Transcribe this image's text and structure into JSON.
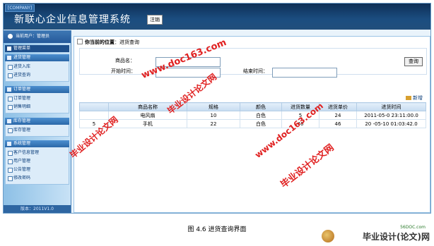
{
  "header": {
    "company": "[COMPANY]",
    "title": "新联心企业信息管理系统",
    "logout": "注销"
  },
  "sidebar": {
    "current_user": "当前用户：管理员",
    "menu_title": "管理菜单",
    "groups": [
      {
        "title": "进货管理",
        "items": [
          "进货入库",
          "进货查询"
        ]
      },
      {
        "title": "订单管理",
        "items": [
          "订单管理",
          "销售明细"
        ]
      },
      {
        "title": "库存管理",
        "items": [
          "库存管理"
        ]
      },
      {
        "title": "系统管理",
        "items": [
          "客户信息管理",
          "用户管理",
          "公告管理",
          "修改密码"
        ]
      }
    ],
    "version": "版本：2011V1.0"
  },
  "main": {
    "position_label": "你当前的位置",
    "position_value": "：进货查询",
    "search": {
      "name_label": "商品名：",
      "name_value": "",
      "start_label": "开始时间：",
      "start_value": "",
      "end_label": "结束时间：",
      "end_value": "",
      "query_button": "查询"
    },
    "new_button": "新增",
    "table": {
      "headers": [
        "",
        "商品名称",
        "规格",
        "颜色",
        "进货数量",
        "进货单价",
        "进货时间"
      ],
      "rows": [
        [
          "",
          "电风扇",
          "10",
          "白色",
          "5",
          "24",
          "2011-05-0  23:11:00.0"
        ],
        [
          "5",
          "手机",
          "22",
          "白色",
          "40",
          "46",
          "20  -05-10 01:03:42.0"
        ]
      ]
    }
  },
  "watermarks": [
    "www.doc163.com",
    "毕业设计论文网",
    "毕业设计论文网",
    "www.doc163.com",
    "毕业设计论文网"
  ],
  "caption": "图 4.6  进货查询界面",
  "corner": {
    "site": "56DOC.com",
    "brand": "毕业设计(论文)网"
  }
}
